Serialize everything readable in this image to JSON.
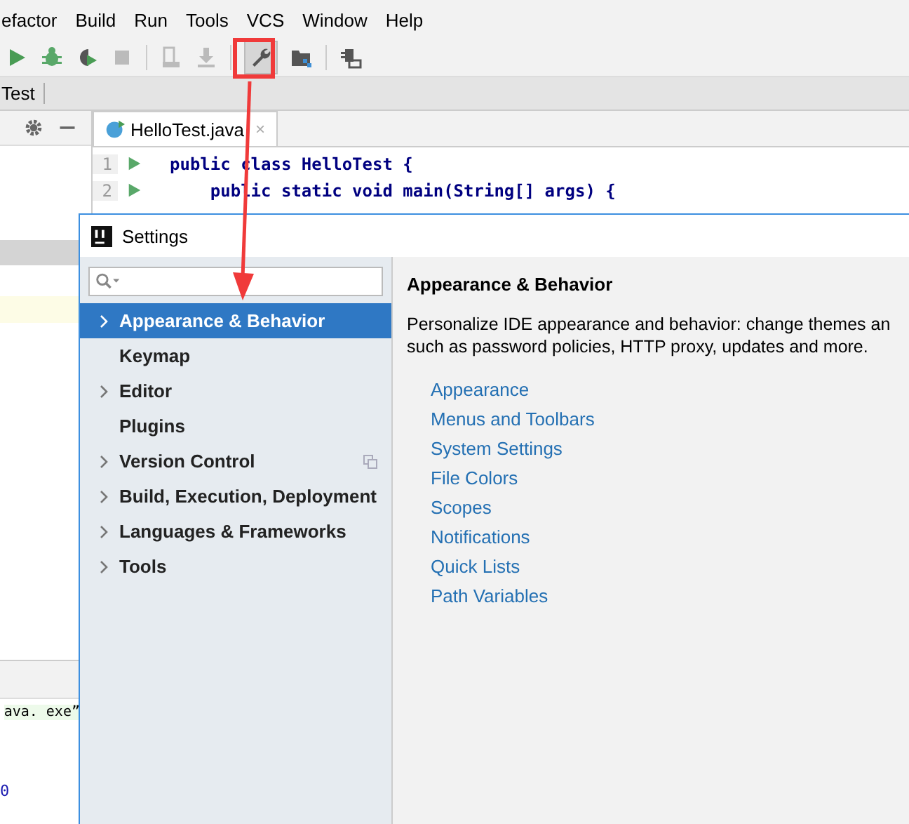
{
  "menu": [
    "efactor",
    "Build",
    "Run",
    "Tools",
    "VCS",
    "Window",
    "Help"
  ],
  "breadcrumb": "Test",
  "editor_tab": {
    "label": "HelloTest.java",
    "close": "×"
  },
  "code": [
    {
      "number": "1",
      "text": "public class HelloTest {"
    },
    {
      "number": "2",
      "text": "    public static void main(String[] args) {"
    }
  ],
  "console": {
    "line": "ava. exe”",
    "exit": "0"
  },
  "settings": {
    "title": "Settings",
    "items": [
      {
        "label": "Appearance & Behavior",
        "kind": "group",
        "selected": true
      },
      {
        "label": "Keymap",
        "kind": "leaf",
        "selected": false
      },
      {
        "label": "Editor",
        "kind": "group",
        "selected": false
      },
      {
        "label": "Plugins",
        "kind": "leaf",
        "selected": false
      },
      {
        "label": "Version Control",
        "kind": "group",
        "selected": false,
        "project_level": true
      },
      {
        "label": "Build, Execution, Deployment",
        "kind": "group",
        "selected": false
      },
      {
        "label": "Languages & Frameworks",
        "kind": "group",
        "selected": false
      },
      {
        "label": "Tools",
        "kind": "group",
        "selected": false
      }
    ],
    "heading": "Appearance & Behavior",
    "description": [
      "Personalize IDE appearance and behavior: change themes an",
      "such as password policies, HTTP proxy, updates and more."
    ],
    "links": [
      "Appearance",
      "Menus and Toolbars",
      "System Settings",
      "File Colors",
      "Scopes",
      "Notifications",
      "Quick Lists",
      "Path Variables"
    ]
  }
}
